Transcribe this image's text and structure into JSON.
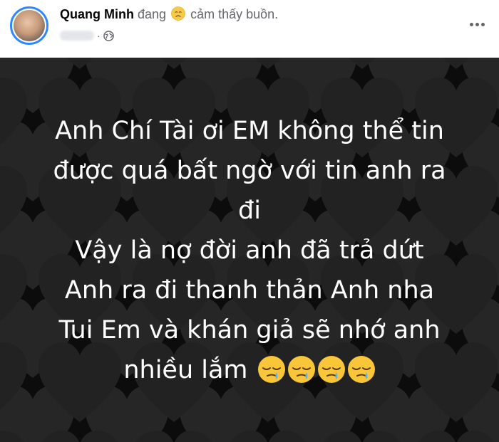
{
  "header": {
    "author": "Quang Minh",
    "feeling_prefix": "đang",
    "feeling_text": "cảm thấy buồn.",
    "feeling_icon": "sad-face-icon",
    "privacy_icon": "globe-icon",
    "more_icon": "more-options-icon"
  },
  "post": {
    "background_color": "#0c0c0c",
    "pattern_icon": "heart-pattern",
    "lines": [
      "Anh Chí Tài ơi EM không thể tin",
      "được quá bất ngờ với tin anh ra",
      "đi",
      "Vậy là nợ đời anh đã trả dứt",
      "Anh ra đi thanh thản Anh nha",
      "Tui Em và khán giả sẽ nhớ anh",
      "nhiều lắm"
    ],
    "emoji_icon": "crying-sleepy-face-icon",
    "emoji_count": 4
  },
  "colors": {
    "accent": "#2d88ff",
    "text_primary": "#050505",
    "text_secondary": "#65676b"
  }
}
